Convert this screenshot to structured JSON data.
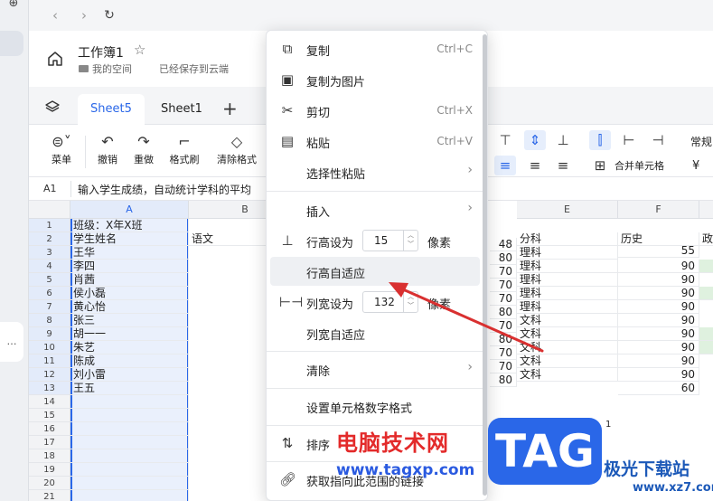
{
  "nav": {
    "back": "‹",
    "forward": "›",
    "refresh": "↻"
  },
  "rail": {
    "more": "…"
  },
  "header": {
    "title": "工作簿1",
    "space": "我的空间",
    "saved": "已经保存到云端"
  },
  "tabs": [
    {
      "label": "Sheet5",
      "active": true
    },
    {
      "label": "Sheet1",
      "active": false
    }
  ],
  "toolbar": {
    "items": [
      {
        "label": "菜单"
      },
      {
        "label": "撤销"
      },
      {
        "label": "重做"
      },
      {
        "label": "格式刷"
      },
      {
        "label": "清除格式"
      }
    ],
    "merge_label": "合并单元格",
    "format_label": "常规",
    "currency": "¥"
  },
  "formula": {
    "cell_ref": "A1",
    "text": "输入学生成绩，自动统计学科的平均"
  },
  "grid": {
    "columns": [
      "A",
      "B",
      "E",
      "F"
    ],
    "rows": [
      "1",
      "2",
      "3",
      "4",
      "5",
      "6",
      "7",
      "8",
      "9",
      "10",
      "11",
      "12",
      "13",
      "14",
      "15",
      "16",
      "17",
      "18",
      "19",
      "20",
      "21"
    ],
    "a_cells": [
      "班级：X年X班",
      "学生姓名",
      "王华",
      "李四",
      "肖茜",
      "侯小磊",
      "黄心怡",
      "张三",
      "胡一一",
      "朱艺",
      "陈成",
      "刘小雷",
      "王五"
    ],
    "b_header": "语文",
    "e_header": "分科",
    "f_header": "历史",
    "g_header": "政",
    "e_values": [
      "理科",
      "理科",
      "理科",
      "理科",
      "理科",
      "文科",
      "文科",
      "文科",
      "文科",
      "文科"
    ],
    "d_values": [
      "48",
      "80",
      "70",
      "70",
      "70",
      "80",
      "70",
      "80",
      "70",
      "70",
      "80"
    ],
    "f_values": [
      "55",
      "90",
      "90",
      "90",
      "90",
      "90",
      "90",
      "90",
      "90",
      "90",
      "60"
    ],
    "stray": "1"
  },
  "menu": {
    "copy": {
      "label": "复制",
      "key": "Ctrl+C"
    },
    "copy_image": {
      "label": "复制为图片"
    },
    "cut": {
      "label": "剪切",
      "key": "Ctrl+X"
    },
    "paste": {
      "label": "粘贴",
      "key": "Ctrl+V"
    },
    "paste_special": {
      "label": "选择性粘贴"
    },
    "insert": {
      "label": "插入"
    },
    "row_height": {
      "label": "行高设为",
      "value": "15",
      "unit": "像素"
    },
    "row_auto": {
      "label": "行高自适应"
    },
    "col_width": {
      "label": "列宽设为",
      "value": "132",
      "unit": "像素"
    },
    "col_auto": {
      "label": "列宽自适应"
    },
    "clear": {
      "label": "清除"
    },
    "number_format": {
      "label": "设置单元格数字格式"
    },
    "sort": {
      "label": "排序"
    },
    "link": {
      "label": "获取指向此范围的链接"
    }
  },
  "watermark": {
    "site_cn": "电脑技术网",
    "site_url": "www.tagxp.com",
    "badge": "TAG",
    "brand": "极光下载站",
    "brand_url": "www.xz7.com"
  },
  "colors": {
    "accent": "#2a67e8",
    "arrow": "#d93030"
  }
}
